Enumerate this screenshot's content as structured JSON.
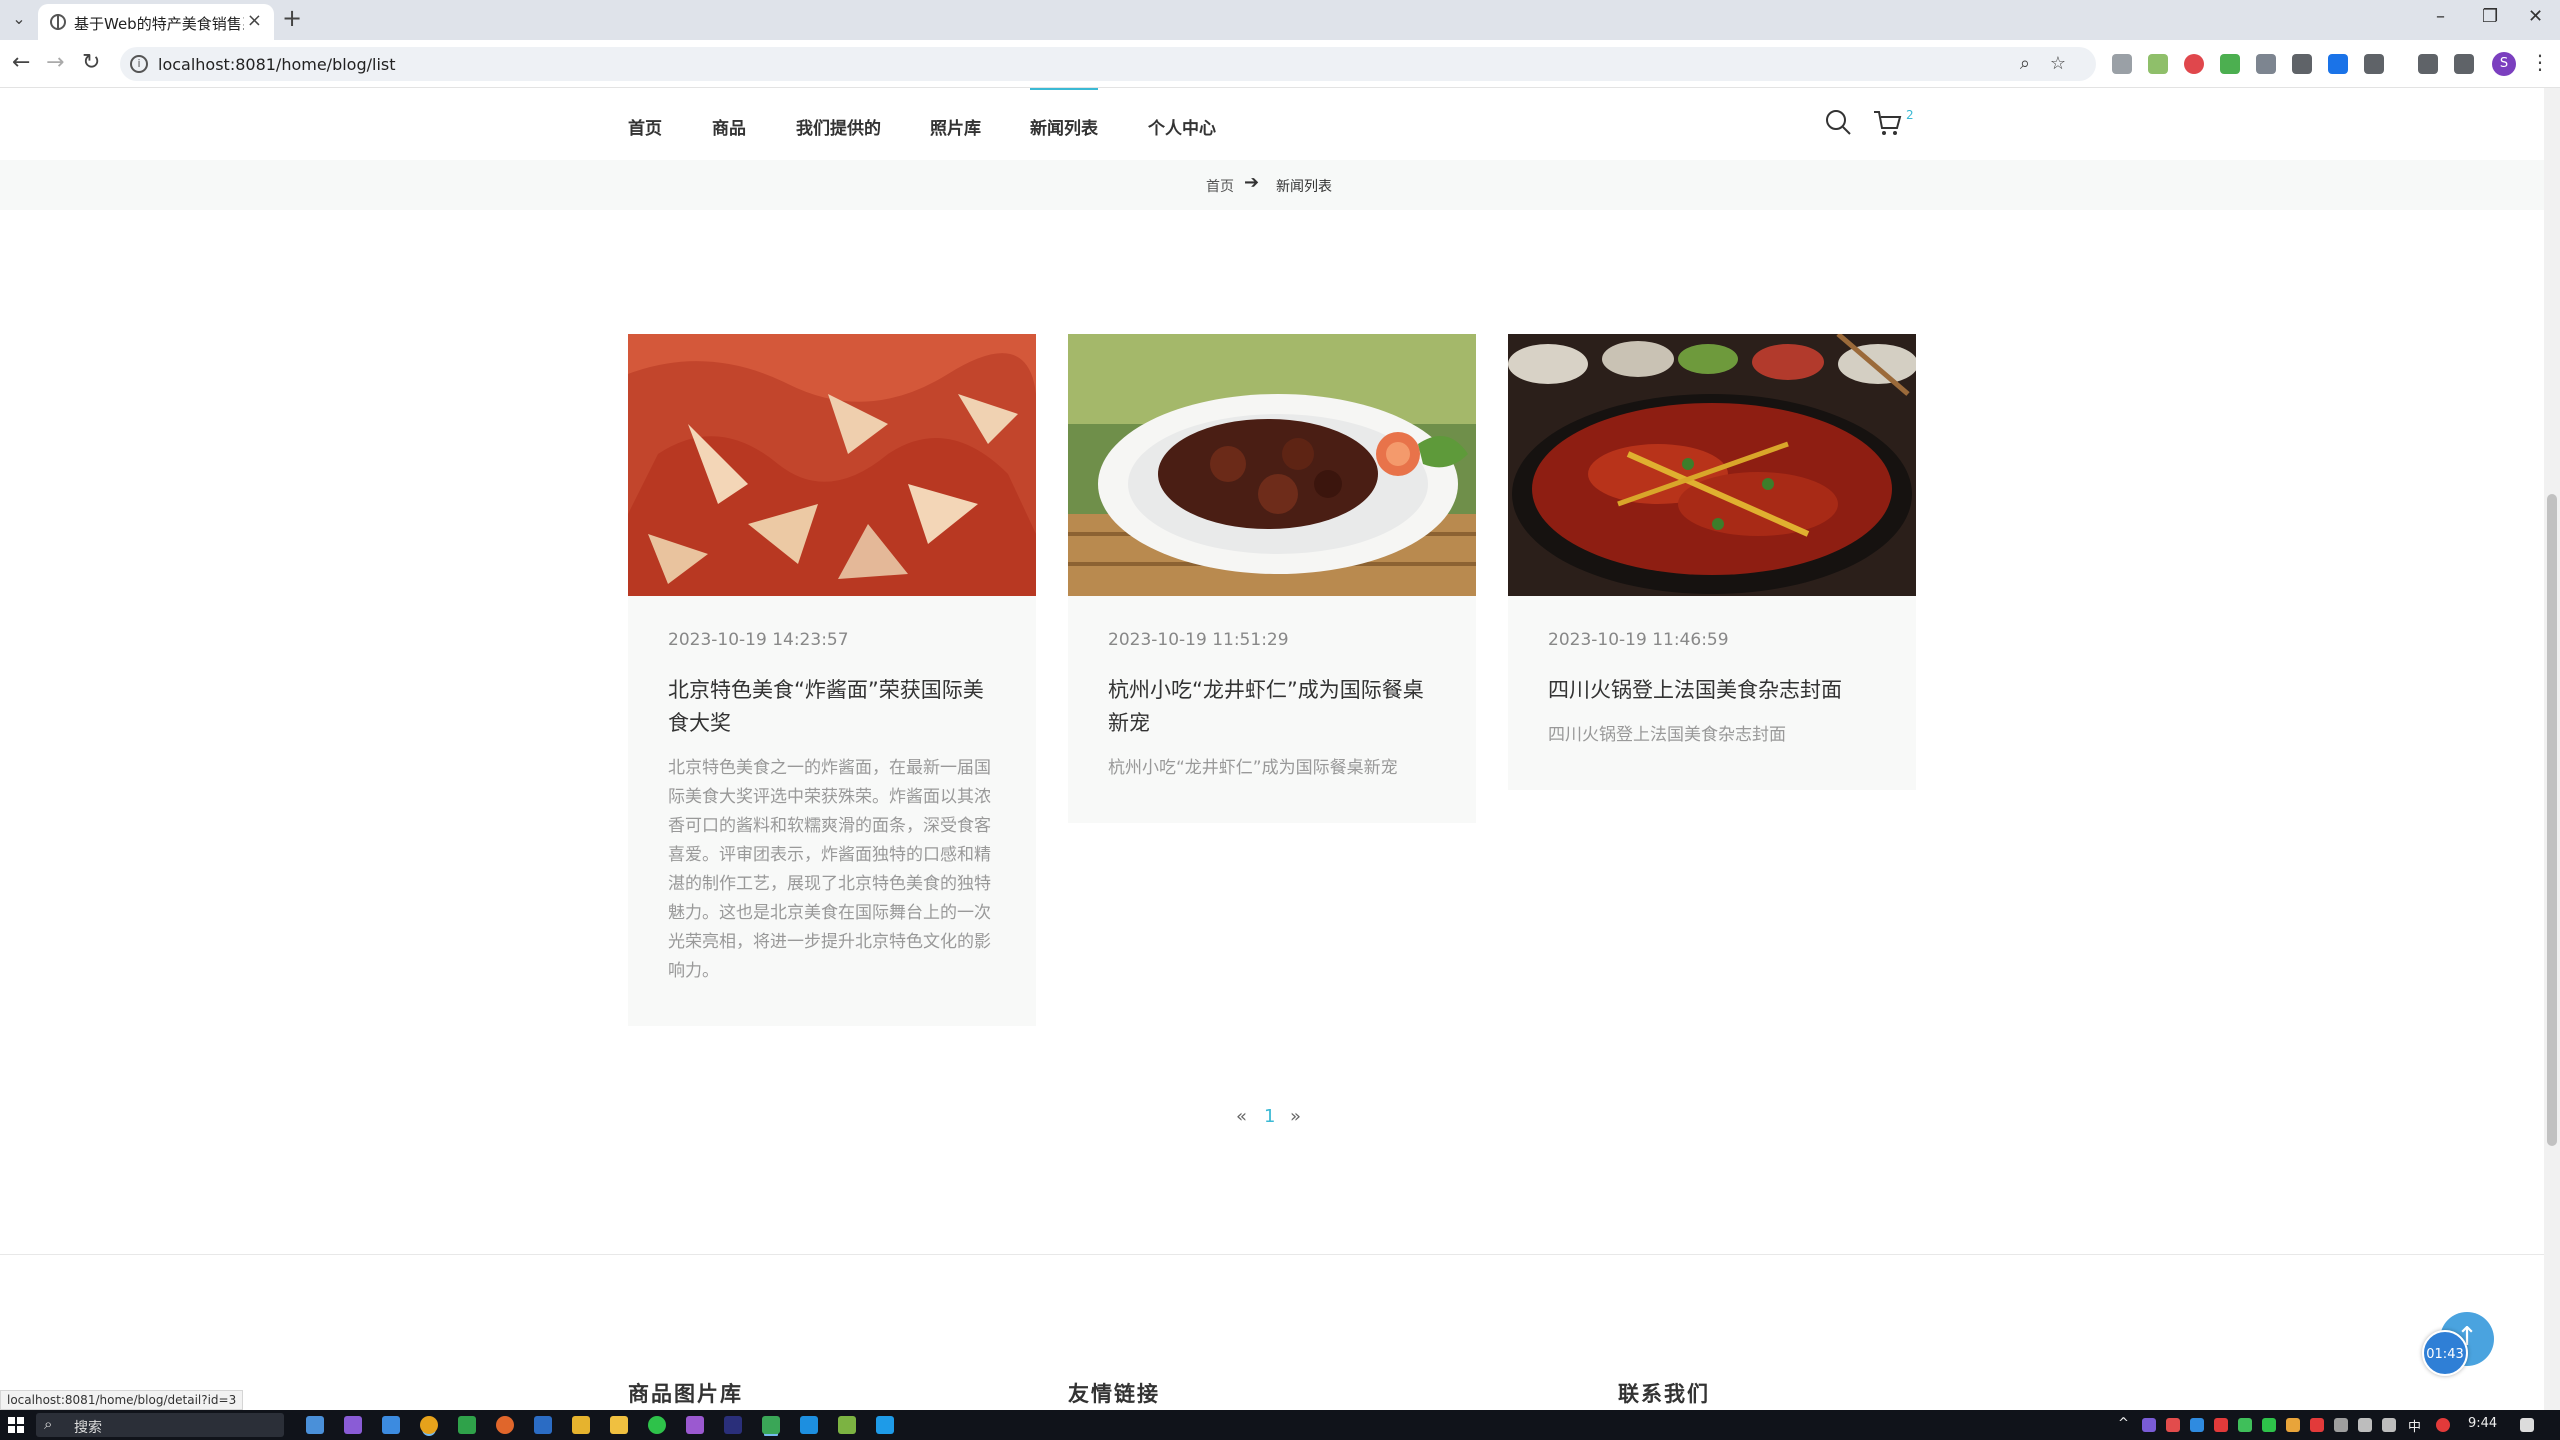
{
  "browser": {
    "tab_title": "基于Web的特产美食销售系统",
    "url": "localhost:8081/home/blog/list",
    "profile_initial": "S"
  },
  "nav": {
    "items": [
      {
        "label": "首页"
      },
      {
        "label": "商品"
      },
      {
        "label": "我们提供的"
      },
      {
        "label": "照片库"
      },
      {
        "label": "新闻列表",
        "active": true
      },
      {
        "label": "个人中心"
      }
    ],
    "cart_count": "2",
    "accent_color": "#3bb9d4"
  },
  "breadcrumb": {
    "home": "首页",
    "current": "新闻列表"
  },
  "posts": [
    {
      "date": "2023-10-19 14:23:57",
      "title": "北京特色美食“炸酱面”荣获国际美食大奖",
      "excerpt": "北京特色美食之一的炸酱面，在最新一届国际美食大奖评选中荣获殊荣。炸酱面以其浓香可口的酱料和软糯爽滑的面条，深受食客喜爱。评审团表示，炸酱面独特的口感和精湛的制作工艺，展现了北京特色美食的独特魅力。这也是北京美食在国际舞台上的一次光荣亮相，将进一步提升北京特色文化的影响力。",
      "image": "pickled-cabbage-photo"
    },
    {
      "date": "2023-10-19 11:51:29",
      "title": "杭州小吃“龙井虾仁”成为国际餐桌新宠",
      "excerpt": "杭州小吃“龙井虾仁”成为国际餐桌新宠",
      "image": "braised-meat-plate-photo"
    },
    {
      "date": "2023-10-19 11:46:59",
      "title": "四川火锅登上法国美食杂志封面",
      "excerpt": "四川火锅登上法国美食杂志封面",
      "image": "sichuan-hotpot-photo"
    }
  ],
  "pagination": {
    "prev": "«",
    "current": "1",
    "next": "»"
  },
  "footer": {
    "gallery_heading": "商品图片库",
    "links_heading": "友情链接",
    "contact_heading": "联系我们"
  },
  "floating": {
    "timer": "01:43",
    "back_to_top": "↑"
  },
  "status_bar_url": "localhost:8081/home/blog/detail?id=3",
  "taskbar": {
    "search_placeholder": "搜索",
    "ime": "中",
    "clock": "9:44"
  }
}
